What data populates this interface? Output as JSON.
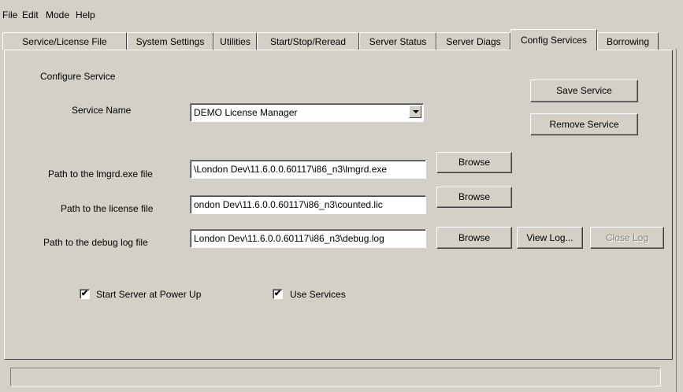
{
  "menu": [
    "File",
    "Edit",
    "Mode",
    "Help"
  ],
  "tabs": [
    {
      "label": "Service/License File",
      "active": false
    },
    {
      "label": "System Settings",
      "active": false
    },
    {
      "label": "Utilities",
      "active": false
    },
    {
      "label": "Start/Stop/Reread",
      "active": false
    },
    {
      "label": "Server Status",
      "active": false
    },
    {
      "label": "Server Diags",
      "active": false
    },
    {
      "label": "Config Services",
      "active": true
    },
    {
      "label": "Borrowing",
      "active": false
    }
  ],
  "config": {
    "section_label": "Configure Service",
    "service_name_label": "Service Name",
    "service_name_value": "DEMO License Manager",
    "save_service": "Save Service",
    "remove_service": "Remove Service",
    "lmgrd_label": "Path to the lmgrd.exe file",
    "lmgrd_value": "\\London Dev\\11.6.0.0.60117\\i86_n3\\lmgrd.exe",
    "license_label": "Path to the license file",
    "license_value": "ondon Dev\\11.6.0.0.60117\\i86_n3\\counted.lic",
    "debug_label": "Path to the debug log file",
    "debug_value": "London Dev\\11.6.0.0.60117\\i86_n3\\debug.log",
    "browse": "Browse",
    "view_log": "View Log...",
    "close_log": "Close Log",
    "start_server_label": "Start Server at Power Up",
    "start_server_checked": true,
    "use_services_label": "Use Services",
    "use_services_checked": true,
    "check_mark": "✔"
  },
  "status": {
    "text": ""
  }
}
